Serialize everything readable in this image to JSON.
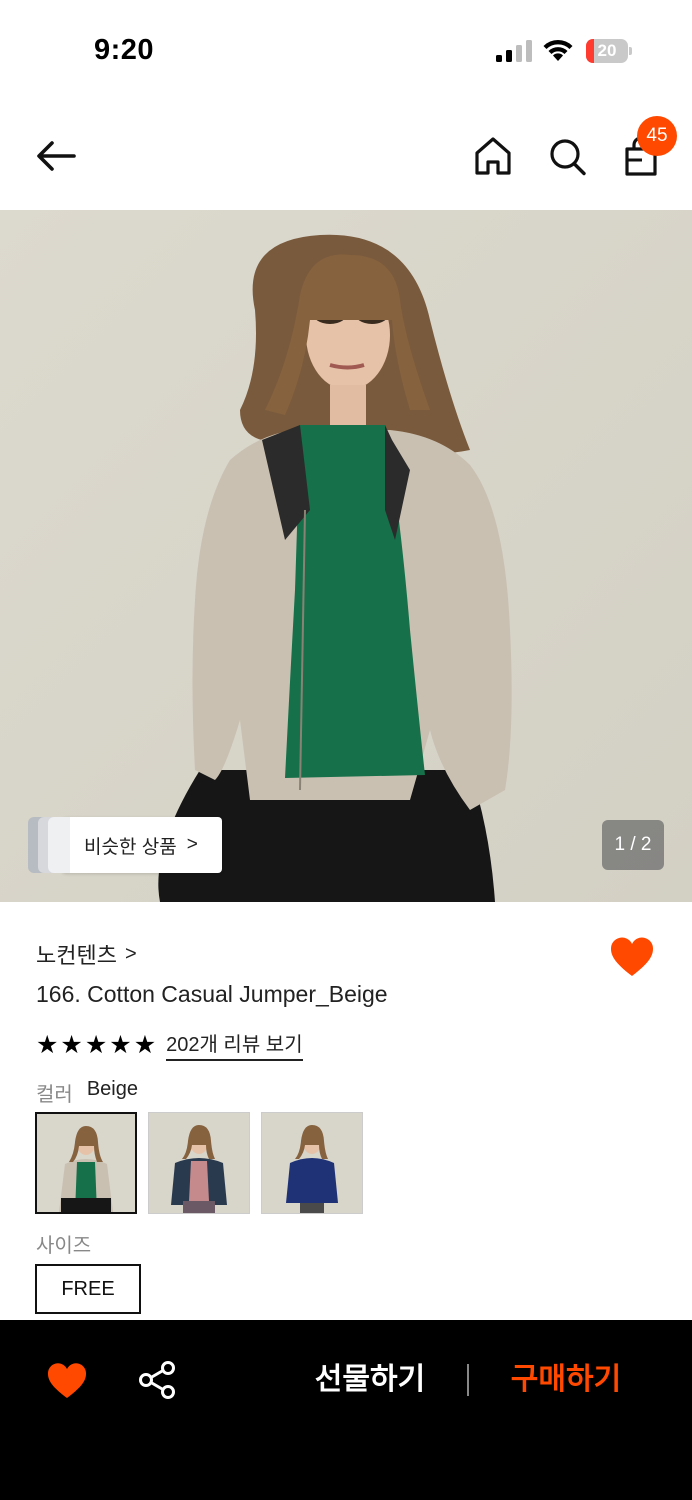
{
  "status_bar": {
    "time": "9:20",
    "battery_level": "20",
    "battery_fraction": 0.2,
    "icons": [
      "signal-icon",
      "wifi-icon",
      "battery-icon"
    ]
  },
  "header": {
    "icons": [
      "back-arrow-icon",
      "home-icon",
      "search-icon",
      "shopping-bag-icon"
    ],
    "cart_count": "45"
  },
  "gallery": {
    "similar_label": "비슷한 상품",
    "similar_chevron": ">",
    "page_counter": "1 / 2"
  },
  "product": {
    "brand": "노컨텐츠",
    "brand_chevron": ">",
    "title": "166. Cotton Casual Jumper_Beige",
    "rating_stars": 5,
    "review_link": "202개 리뷰 보기",
    "color_label": "컬러",
    "color_value": "Beige",
    "size_label": "사이즈",
    "size_option": "FREE"
  },
  "bottom_bar": {
    "gift_label": "선물하기",
    "buy_label": "구매하기"
  },
  "colors": {
    "accent": "#ff4800",
    "bottom_bar_bg": "#000000"
  }
}
